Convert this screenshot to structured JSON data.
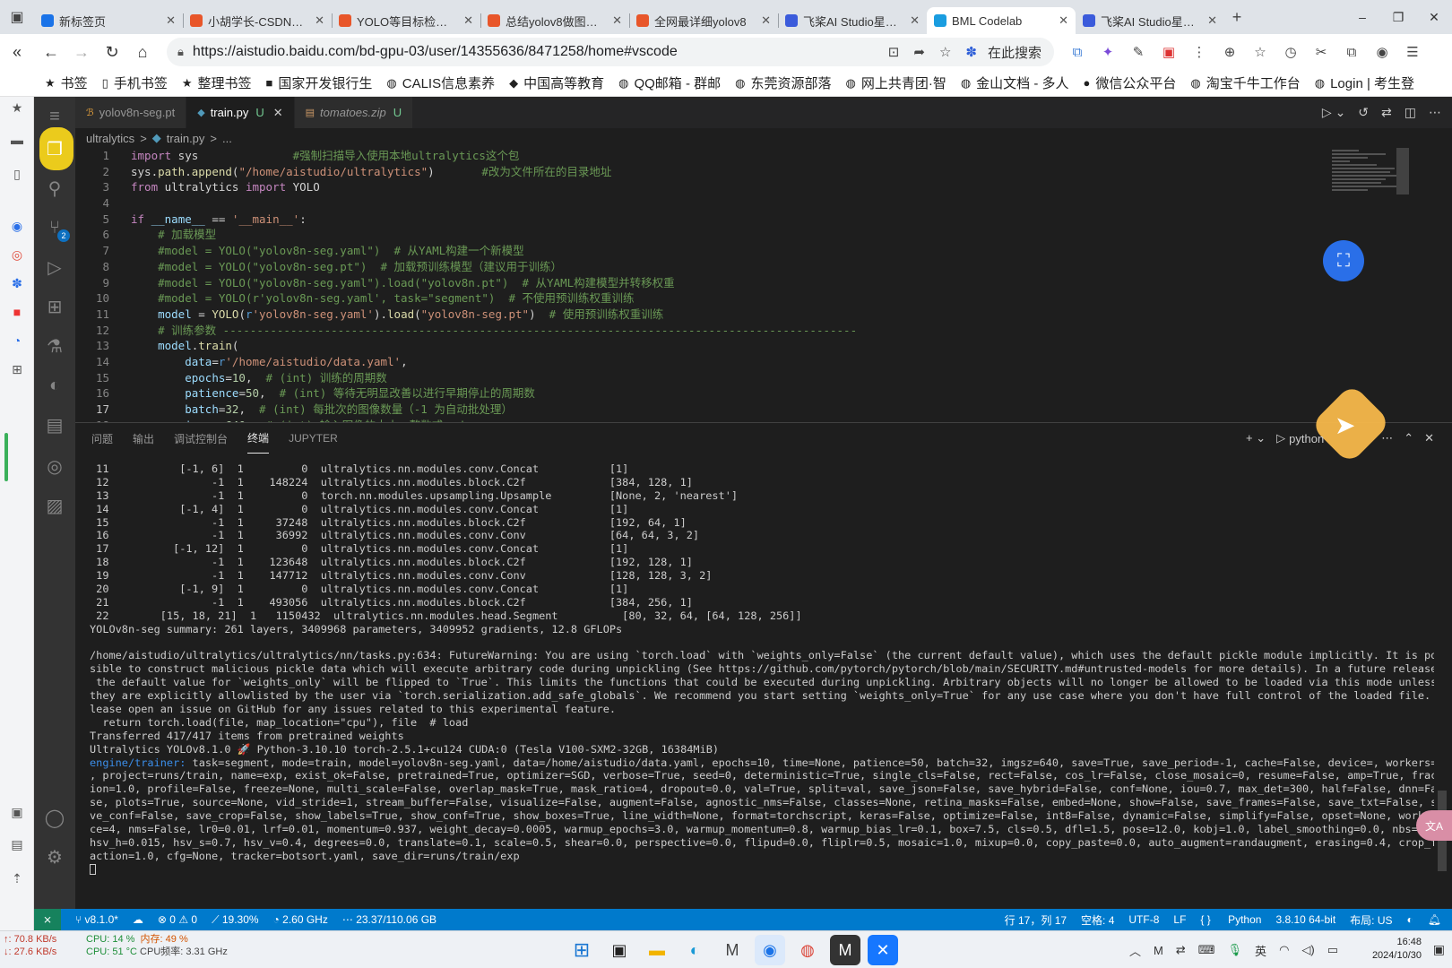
{
  "browser": {
    "tabs": [
      {
        "title": "新标签页",
        "color": "#1a73e8",
        "active": false
      },
      {
        "title": "小胡学长-CSDN博客",
        "color": "#e8562a",
        "active": false
      },
      {
        "title": "YOLO等目标检测模型",
        "color": "#e8562a",
        "active": false
      },
      {
        "title": "总结yolov8做图像分割",
        "color": "#e8562a",
        "active": false
      },
      {
        "title": "全网最详细yolov8",
        "color": "#e8562a",
        "active": false
      },
      {
        "title": "飞桨AI Studio星河社区",
        "color": "#3b5bdb",
        "active": false
      },
      {
        "title": "BML Codelab",
        "color": "#1a9de0",
        "active": true
      },
      {
        "title": "飞桨AI Studio星河社区",
        "color": "#3b5bdb",
        "active": false
      }
    ],
    "url": "https://aistudio.baidu.com/bd-gpu-03/user/14355636/8471258/home#vscode",
    "search_here": "在此搜索",
    "bookmarks": [
      {
        "label": "书签",
        "icon": "★"
      },
      {
        "label": "手机书签",
        "icon": "▯"
      },
      {
        "label": "整理书签",
        "icon": "★"
      },
      {
        "label": "国家开发银行生",
        "icon": "■"
      },
      {
        "label": "CALIS信息素养",
        "icon": "◍"
      },
      {
        "label": "中国高等教育",
        "icon": "◆"
      },
      {
        "label": "QQ邮箱 - 群邮",
        "icon": "◍"
      },
      {
        "label": "东莞资源部落",
        "icon": "◍"
      },
      {
        "label": "网上共青团·智",
        "icon": "◍"
      },
      {
        "label": "金山文档 - 多人",
        "icon": "◍"
      },
      {
        "label": "微信公众平台",
        "icon": "●"
      },
      {
        "label": "淘宝千牛工作台",
        "icon": "◍"
      },
      {
        "label": "Login | 考生登",
        "icon": "◍"
      }
    ]
  },
  "editor": {
    "tabs": [
      {
        "name": "yolov8n-seg.pt",
        "icon": "ℬ",
        "flag": "",
        "active": false,
        "italic": false
      },
      {
        "name": "train.py",
        "icon": "◆",
        "flag": "U",
        "active": true,
        "italic": false
      },
      {
        "name": "tomatoes.zip",
        "icon": "▤",
        "flag": "U",
        "active": false,
        "italic": true
      }
    ],
    "breadcrumb": [
      "ultralytics",
      ">",
      "train.py",
      ">",
      "..."
    ],
    "lines": [
      {
        "n": "1",
        "html": "<span class='kw'>import</span> sys              <span class='c'>#强制扫描导入使用本地ultralytics这个包</span>"
      },
      {
        "n": "2",
        "html": "sys.<span class='f'>path</span>.<span class='f'>append</span>(<span class='s'>\"/home/aistudio/ultralytics\"</span>)       <span class='c'>#改为文件所在的目录地址</span>"
      },
      {
        "n": "3",
        "html": "<span class='kw'>from</span> ultralytics <span class='kw'>import</span> YOLO"
      },
      {
        "n": "4",
        "html": ""
      },
      {
        "n": "5",
        "html": "<span class='kw'>if</span> <span class='v'>__name__</span> == <span class='s'>'__main__'</span>:"
      },
      {
        "n": "6",
        "html": "    <span class='c'># 加载模型</span>"
      },
      {
        "n": "7",
        "html": "    <span class='c'>#model = YOLO(\"yolov8n-seg.yaml\")  # 从YAML构建一个新模型</span>"
      },
      {
        "n": "8",
        "html": "    <span class='c'>#model = YOLO(\"yolov8n-seg.pt\")  # 加载预训练模型（建议用于训练）</span>"
      },
      {
        "n": "9",
        "html": "    <span class='c'>#model = YOLO(\"yolov8n-seg.yaml\").load(\"yolov8n.pt\")  # 从YAML构建模型并转移权重</span>"
      },
      {
        "n": "10",
        "html": "    <span class='c'>#model = YOLO(r'yolov8n-seg.yaml', task=\"segment\")  # 不使用预训练权重训练</span>"
      },
      {
        "n": "11",
        "html": "    <span class='v'>model</span> = <span class='f'>YOLO</span>(<span class='k'>r</span><span class='s'>'yolov8n-seg.yaml'</span>).<span class='f'>load</span>(<span class='s'>\"yolov8n-seg.pt\"</span>)  <span class='c'># 使用预训练权重训练</span>"
      },
      {
        "n": "12",
        "html": "    <span class='c'># 训练参数 ----------------------------------------------------------------------------------------------</span>"
      },
      {
        "n": "13",
        "html": "    <span class='v'>model</span>.<span class='f'>train</span>("
      },
      {
        "n": "14",
        "html": "        <span class='v'>data</span>=<span class='k'>r</span><span class='s'>'/home/aistudio/data.yaml'</span>,"
      },
      {
        "n": "15",
        "html": "        <span class='v'>epochs</span>=<span class='n'>10</span>,  <span class='c'># (int) 训练的周期数</span>"
      },
      {
        "n": "16",
        "html": "        <span class='v'>patience</span>=<span class='n'>50</span>,  <span class='c'># (int) 等待无明显改善以进行早期停止的周期数</span>"
      },
      {
        "n": "17",
        "html": "        <span class='v'>batch</span>=<span class='n'>32</span>,  <span class='c'># (int) 每批次的图像数量（-1 为自动批处理）</span>"
      },
      {
        "n": "18",
        "html": "        <span class='v'>imgsz</span>=<span class='n'>640</span>,  <span class='c'># (int) 输入图像的大小，整数或w，h</span>"
      }
    ]
  },
  "panel": {
    "tabs": [
      "问题",
      "输出",
      "调试控制台",
      "终端",
      "JUPYTER"
    ],
    "active_tab": "终端",
    "terminal_name": "python",
    "lines": [
      " 11           [-1, 6]  1         0  ultralytics.nn.modules.conv.Concat           [1]",
      " 12                -1  1    148224  ultralytics.nn.modules.block.C2f             [384, 128, 1]",
      " 13                -1  1         0  torch.nn.modules.upsampling.Upsample         [None, 2, 'nearest']",
      " 14           [-1, 4]  1         0  ultralytics.nn.modules.conv.Concat           [1]",
      " 15                -1  1     37248  ultralytics.nn.modules.block.C2f             [192, 64, 1]",
      " 16                -1  1     36992  ultralytics.nn.modules.conv.Conv             [64, 64, 3, 2]",
      " 17          [-1, 12]  1         0  ultralytics.nn.modules.conv.Concat           [1]",
      " 18                -1  1    123648  ultralytics.nn.modules.block.C2f             [192, 128, 1]",
      " 19                -1  1    147712  ultralytics.nn.modules.conv.Conv             [128, 128, 3, 2]",
      " 20           [-1, 9]  1         0  ultralytics.nn.modules.conv.Concat           [1]",
      " 21                -1  1    493056  ultralytics.nn.modules.block.C2f             [384, 256, 1]",
      " 22        [15, 18, 21]  1   1150432  ultralytics.nn.modules.head.Segment          [80, 32, 64, [64, 128, 256]]",
      "YOLOv8n-seg summary: 261 layers, 3409968 parameters, 3409952 gradients, 12.8 GFLOPs",
      "",
      "/home/aistudio/ultralytics/ultralytics/nn/tasks.py:634: FutureWarning: You are using `torch.load` with `weights_only=False` (the current default value), which uses the default pickle module implicitly. It is pos",
      "sible to construct malicious pickle data which will execute arbitrary code during unpickling (See https://github.com/pytorch/pytorch/blob/main/SECURITY.md#untrusted-models for more details). In a future release,",
      " the default value for `weights_only` will be flipped to `True`. This limits the functions that could be executed during unpickling. Arbitrary objects will no longer be allowed to be loaded via this mode unless",
      "they are explicitly allowlisted by the user via `torch.serialization.add_safe_globals`. We recommend you start setting `weights_only=True` for any use case where you don't have full control of the loaded file. P",
      "lease open an issue on GitHub for any issues related to this experimental feature.",
      "  return torch.load(file, map_location=\"cpu\"), file  # load",
      "Transferred 417/417 items from pretrained weights",
      "Ultralytics YOLOv8.1.0 🚀 Python-3.10.10 torch-2.5.1+cu124 CUDA:0 (Tesla V100-SXM2-32GB, 16384MiB)",
      "engine/trainer: task=segment, mode=train, model=yolov8n-seg.yaml, data=/home/aistudio/data.yaml, epochs=10, time=None, patience=50, batch=32, imgsz=640, save=True, save_period=-1, cache=False, device=, workers=8",
      ", project=runs/train, name=exp, exist_ok=False, pretrained=True, optimizer=SGD, verbose=True, seed=0, deterministic=True, single_cls=False, rect=False, cos_lr=False, close_mosaic=0, resume=False, amp=True, fract",
      "ion=1.0, profile=False, freeze=None, multi_scale=False, overlap_mask=True, mask_ratio=4, dropout=0.0, val=True, split=val, save_json=False, save_hybrid=False, conf=None, iou=0.7, max_det=300, half=False, dnn=Fal",
      "se, plots=True, source=None, vid_stride=1, stream_buffer=False, visualize=False, augment=False, agnostic_nms=False, classes=None, retina_masks=False, embed=None, show=False, save_frames=False, save_txt=False, sa",
      "ve_conf=False, save_crop=False, show_labels=True, show_conf=True, show_boxes=True, line_width=None, format=torchscript, keras=False, optimize=False, int8=False, dynamic=False, simplify=False, opset=None, workspa",
      "ce=4, nms=False, lr0=0.01, lrf=0.01, momentum=0.937, weight_decay=0.0005, warmup_epochs=3.0, warmup_momentum=0.8, warmup_bias_lr=0.1, box=7.5, cls=0.5, dfl=1.5, pose=12.0, kobj=1.0, label_smoothing=0.0, nbs=64,",
      "hsv_h=0.015, hsv_s=0.7, hsv_v=0.4, degrees=0.0, translate=0.1, scale=0.5, shear=0.0, perspective=0.0, flipud=0.0, fliplr=0.5, mosaic=1.0, mixup=0.0, copy_paste=0.0, auto_augment=randaugment, erasing=0.4, crop_fr",
      "action=1.0, cfg=None, tracker=botsort.yaml, save_dir=runs/train/exp"
    ],
    "engine_prefix": "engine/trainer:"
  },
  "statusbar": {
    "version": "v8.1.0*",
    "errors": "0",
    "warnings": "0",
    "cpu": "19.30%",
    "freq": "2.60 GHz",
    "mem": "23.37/110.06 GB",
    "position": "行 17，列 17",
    "spaces": "空格: 4",
    "encoding": "UTF-8",
    "eol": "LF",
    "language": "Python",
    "interpreter": "3.8.10 64-bit",
    "layout": "布局: US"
  },
  "taskbar": {
    "net_up": "↑: 70.8 KB/s",
    "net_down": "↓: 27.6 KB/s",
    "cpu_line1": "CPU: 14 %",
    "mem_line1": "内存: 49 %",
    "cpu_line2": "CPU: 51 °C",
    "cpu_freq": "CPU频率: 3.31 GHz",
    "time": "16:48",
    "date": "2024/10/30",
    "ime": "英"
  }
}
